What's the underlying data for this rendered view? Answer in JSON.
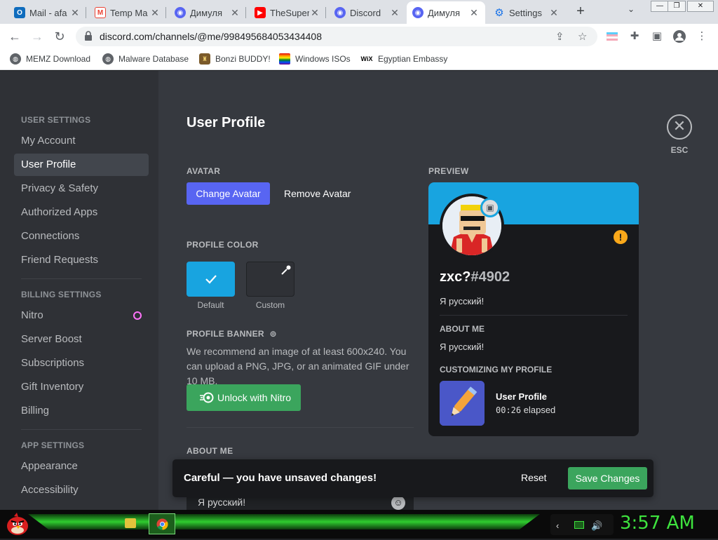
{
  "browser": {
    "tabs": [
      {
        "title": "Mail - afa",
        "favicon": "outlook-icon",
        "color": "#0f6cbd",
        "active": false
      },
      {
        "title": "Temp Ma",
        "favicon": "gmail-icon",
        "color": "#ea4335",
        "active": false
      },
      {
        "title": "Димуля",
        "favicon": "discord-icon",
        "color": "#5865f2",
        "active": false
      },
      {
        "title": "TheSuper",
        "favicon": "youtube-icon",
        "color": "#ff0000",
        "active": false
      },
      {
        "title": "Discord",
        "favicon": "discord-icon",
        "color": "#5865f2",
        "active": false
      },
      {
        "title": "Димуля",
        "favicon": "discord-icon",
        "color": "#5865f2",
        "active": true
      },
      {
        "title": "Settings",
        "favicon": "gear-icon",
        "color": "#1a73e8",
        "active": false
      }
    ],
    "new_tab": "+",
    "url": "discord.com/channels/@me/998495684053434408",
    "bookmarks": [
      {
        "label": "MEMZ Download",
        "icon": "globe-icon"
      },
      {
        "label": "Malware Database",
        "icon": "globe-icon"
      },
      {
        "label": "Bonzi BUDDY!",
        "icon": "bonzi-icon"
      },
      {
        "label": "Windows ISOs",
        "icon": "windows-icon"
      },
      {
        "label": "Egyptian Embassy",
        "icon": "wix-icon"
      }
    ],
    "wix_text": "WiX"
  },
  "sidebar": {
    "user_settings_header": "USER SETTINGS",
    "user_items": [
      "My Account",
      "User Profile",
      "Privacy & Safety",
      "Authorized Apps",
      "Connections",
      "Friend Requests"
    ],
    "selected": "User Profile",
    "billing_header": "BILLING SETTINGS",
    "billing_items": [
      "Nitro",
      "Server Boost",
      "Subscriptions",
      "Gift Inventory",
      "Billing"
    ],
    "app_header": "APP SETTINGS",
    "app_items": [
      "Appearance",
      "Accessibility"
    ]
  },
  "main": {
    "title": "User Profile",
    "avatar_label": "AVATAR",
    "change_avatar": "Change Avatar",
    "remove_avatar": "Remove Avatar",
    "profile_color_label": "PROFILE COLOR",
    "color_default": "Default",
    "color_custom": "Custom",
    "default_color": "#18a4e0",
    "profile_banner_label": "PROFILE BANNER",
    "banner_desc": "We recommend an image of at least 600x240. You can upload a PNG, JPG, or an animated GIF under 10 MB.",
    "unlock_nitro": "Unlock with Nitro",
    "about_me_label": "ABOUT ME",
    "about_me_value": "Я русский!",
    "close_label": "ESC"
  },
  "preview": {
    "label": "PREVIEW",
    "username": "zxc?",
    "discriminator": "#4902",
    "status": "Я русский!",
    "about_header": "ABOUT ME",
    "about_text": "Я русский!",
    "customizing_header": "CUSTOMIZING MY PROFILE",
    "activity_title": "User Profile",
    "activity_time": "00:26",
    "activity_suffix": " elapsed"
  },
  "unsaved": {
    "message": "Careful — you have unsaved changes!",
    "reset": "Reset",
    "save": "Save Changes"
  },
  "taskbar": {
    "clock": "3:57 AM"
  }
}
